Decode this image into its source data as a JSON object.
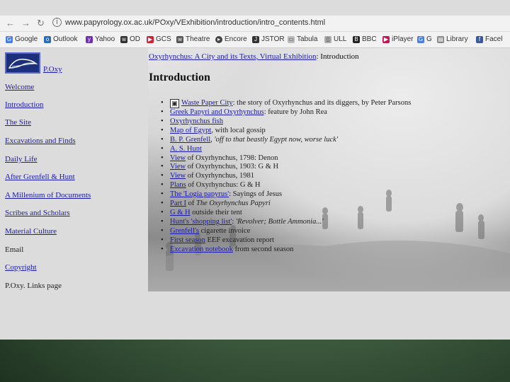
{
  "browser": {
    "url": "www.papyrology.ox.ac.uk/POxy/VExhibition/introduction/intro_contents.html",
    "bookmarks": [
      "Google",
      "Outlook",
      "Yahoo",
      "OD",
      "GCS",
      "Theatre",
      "Encore",
      "JSTOR",
      "Tabula",
      "ULL",
      "BBC",
      "iPlayer",
      "G",
      "Library",
      "Facel"
    ]
  },
  "leftnav": {
    "logo_label": "P.Oxy",
    "items": [
      "Welcome",
      "Introduction",
      "The Site",
      "Excavations and Finds",
      "Daily Life",
      "After Grenfell & Hunt",
      "A Millenium of Documents",
      "Scribes and Scholars",
      "Material Culture",
      "Email",
      "Copyright",
      "P.Oxy. Links page"
    ]
  },
  "main": {
    "breadcrumb_link": "Oxyrhynchus: A City and its Texts, Virtual Exhibition",
    "breadcrumb_rest": ": Introduction",
    "title": "Introduction",
    "items": [
      {
        "link": "Waste Paper City",
        "rest": ": the story of Oxyrhynchus and its diggers, by Peter Parsons",
        "italic": ""
      },
      {
        "link": "Greek Papyri and Oxyrhynchus",
        "rest": ": feature by John Rea",
        "italic": ""
      },
      {
        "link": "Oxyrhynchus fish",
        "rest": "",
        "italic": ""
      },
      {
        "link": "Map of Egypt",
        "rest": ", with local gossip",
        "italic": ""
      },
      {
        "link": "B. P. Grenfell",
        "rest": ", ",
        "italic": "'off to that beastly Egypt now, worse luck'"
      },
      {
        "link": "A. S. Hunt",
        "rest": "",
        "italic": ""
      },
      {
        "link": "View",
        "rest": " of Oxyrhynchus, 1798: Denon",
        "italic": ""
      },
      {
        "link": "View",
        "rest": " of Oxyrhynchus, 1903: G & H",
        "italic": ""
      },
      {
        "link": "View",
        "rest": " of Oxyrhynchus, 1981",
        "italic": ""
      },
      {
        "link": "Plans",
        "rest": " of Oxyrhynchus: G & H",
        "italic": ""
      },
      {
        "link": "The 'Logia papyrus'",
        "rest": ": Sayings of Jesus",
        "italic": ""
      },
      {
        "link": "Part I",
        "rest": " of ",
        "italic": "The Oxyrhynchus Papyri"
      },
      {
        "link": "G & H",
        "rest": " outside their tent",
        "italic": ""
      },
      {
        "link": "Hunt's 'shopping list'",
        "rest": ": ",
        "italic": "'Revolver; Bottle Ammonia...'"
      },
      {
        "link": "Grenfell's",
        "rest": " cigarette invoice",
        "italic": ""
      },
      {
        "link": "First season",
        "rest": " EEF excavation report",
        "italic": ""
      },
      {
        "link": "Excavation notebook",
        "rest": " from second season",
        "italic": ""
      }
    ]
  }
}
